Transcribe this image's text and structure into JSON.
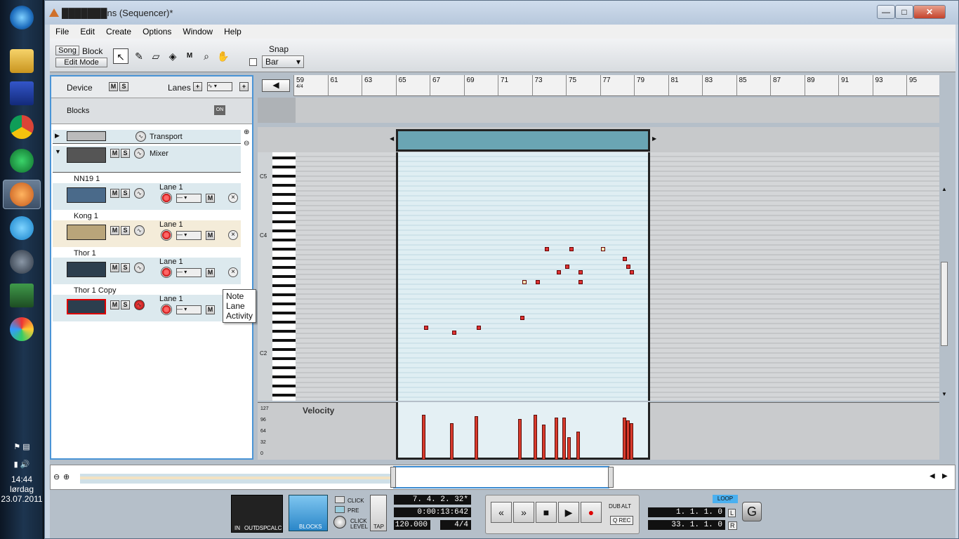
{
  "window": {
    "title": "███████ns (Sequencer)*",
    "minimize": "—",
    "maximize": "□",
    "close": "✕"
  },
  "menu": [
    "File",
    "Edit",
    "Create",
    "Options",
    "Window",
    "Help"
  ],
  "toolbar": {
    "song": "Song",
    "block": "Block",
    "edit_mode": "Edit Mode",
    "snap_label": "Snap",
    "snap_value": "Bar"
  },
  "tools": [
    "↖",
    "✎",
    "▱",
    "◈",
    "M",
    "⌕",
    "✋"
  ],
  "panel": {
    "device": "Device",
    "m": "M",
    "s": "S",
    "lanes": "Lanes",
    "blocks": "Blocks",
    "on": "ON"
  },
  "tracks": [
    {
      "name": "Transport",
      "lane": ""
    },
    {
      "name": "Mixer",
      "lane": ""
    },
    {
      "name": "NN19 1",
      "lane": "Lane 1"
    },
    {
      "name": "Kong 1",
      "lane": "Lane 1"
    },
    {
      "name": "Thor 1",
      "lane": "Lane 1"
    },
    {
      "name": "Thor 1 Copy",
      "lane": "Lane 1"
    }
  ],
  "tooltip": "Note Lane Activity",
  "ruler": {
    "sig": "4/4",
    "bars": [
      "59",
      "61",
      "63",
      "65",
      "67",
      "69",
      "71",
      "73",
      "75",
      "77",
      "79",
      "81",
      "83",
      "85",
      "87",
      "89",
      "91",
      "93",
      "95"
    ]
  },
  "piano": {
    "c5": "C5",
    "c4": "C4",
    "c2": "C2"
  },
  "velocity": {
    "label": "Velocity",
    "ticks": [
      "127",
      "96",
      "64",
      "32",
      "0"
    ]
  },
  "transport": {
    "in": "IN",
    "out": "OUT",
    "dsp": "DSP",
    "calc": "CALC",
    "blocks": "BLOCKS",
    "click": "CLICK",
    "pre": "PRE",
    "click_level": "CLICK\nLEVEL",
    "tap": "TAP",
    "position": "7. 4. 2. 32*",
    "time": "0:00:13:642",
    "tempo": "120.000",
    "signature": "4/4",
    "dub": "DUB",
    "alt": "ALT",
    "qrec": "Q REC",
    "loop": "LOOP",
    "left_loc": "1. 1. 1.   0",
    "right_loc": "33. 1. 1.   0",
    "l": "L",
    "r": "R",
    "rewind": "«",
    "ffwd": "»",
    "stop": "■",
    "play": "▶",
    "record": "●"
  },
  "tray": {
    "time": "14:44",
    "day": "lørdag",
    "date": "23.07.2011"
  },
  "colors": {
    "accent": "#4a94d6",
    "clip": "#6aa5b4",
    "note": "#d33",
    "velocity": "#d83a2c"
  }
}
